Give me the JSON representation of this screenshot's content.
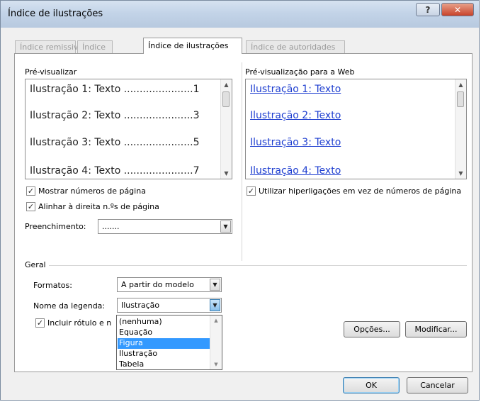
{
  "window": {
    "title": "Índice de ilustrações",
    "help_label": "?",
    "close_label": "✕"
  },
  "tabs": [
    {
      "label": "Índice remissivo",
      "active": false
    },
    {
      "label": "Índice",
      "active": false
    },
    {
      "label": "Índice de ilustrações",
      "active": true
    },
    {
      "label": "Índice de autoridades",
      "active": false
    }
  ],
  "print_preview": {
    "label": "Pré-visualizar",
    "lines": [
      "Ilustração 1: Texto ......................1",
      "Ilustração 2: Texto ......................3",
      "Ilustração 3: Texto ......................5",
      "Ilustração 4: Texto ......................7"
    ]
  },
  "web_preview": {
    "label": "Pré-visualização para a Web",
    "links": [
      "Ilustração 1: Texto",
      "Ilustração 2: Texto",
      "Ilustração 3: Texto",
      "Ilustração 4: Texto"
    ]
  },
  "options": {
    "show_page_numbers": {
      "label": "Mostrar números de página",
      "checked": true
    },
    "right_align": {
      "label": "Alinhar à direita n.ºs de página",
      "checked": true
    },
    "use_hyperlinks": {
      "label": "Utilizar hiperligações em vez de números de página",
      "checked": true
    },
    "tab_leader_label": "Preenchimento:",
    "tab_leader_value": "......."
  },
  "general": {
    "group_label": "Geral",
    "formats_label": "Formatos:",
    "formats_value": "A partir do modelo",
    "caption_label": "Nome da legenda:",
    "caption_value": "Ilustração",
    "include_label_text": "Incluir rótulo e n",
    "include_label_checked": true,
    "caption_options": [
      "(nenhuma)",
      "Equação",
      "Figura",
      "Ilustração",
      "Tabela"
    ],
    "caption_highlighted": "Figura"
  },
  "buttons": {
    "options": "Opções...",
    "modify": "Modificar...",
    "ok": "OK",
    "cancel": "Cancelar"
  },
  "icons": {
    "checkmark": "✓",
    "dropdown_arrow": "▼",
    "scroll_up": "▲",
    "scroll_down": "▼"
  }
}
